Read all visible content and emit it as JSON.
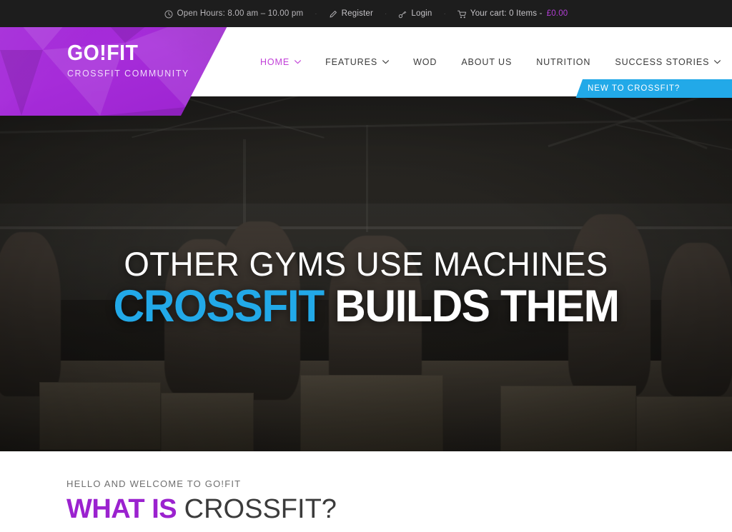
{
  "topbar": {
    "open_hours": "Open Hours: 8.00 am – 10.00 pm",
    "register": "Register",
    "login": "Login",
    "cart_label": "Your cart: 0 Items - ",
    "cart_price": "£0.00",
    "separator": "·",
    "icons": {
      "clock": "clock-icon",
      "register": "pencil-icon",
      "login": "key-icon",
      "cart": "cart-icon"
    }
  },
  "brand": {
    "name": "GO!FIT",
    "tagline": "CROSSFIT COMMUNITY"
  },
  "nav": {
    "items": [
      {
        "label": "HOME",
        "active": true,
        "dropdown": true
      },
      {
        "label": "FEATURES",
        "active": false,
        "dropdown": true
      },
      {
        "label": "WOD",
        "active": false,
        "dropdown": false
      },
      {
        "label": "ABOUT US",
        "active": false,
        "dropdown": false
      },
      {
        "label": "NUTRITION",
        "active": false,
        "dropdown": false
      },
      {
        "label": "SUCCESS STORIES",
        "active": false,
        "dropdown": true
      }
    ],
    "cta_label": "NEW TO CROSSFIT?"
  },
  "hero": {
    "line1": "OTHER GYMS USE MACHINES",
    "line2_accent": "CROSSFIT",
    "line2_rest": " BUILDS THEM"
  },
  "welcome": {
    "eyebrow": "HELLO AND WELCOME TO GO!FIT",
    "title_bold": "WHAT IS",
    "title_light": " CROSSFIT?"
  },
  "colors": {
    "brand_purple": "#9b22cf",
    "accent_blue": "#22a9e8",
    "topbar_bg": "#1d1d1d",
    "nav_active": "#c13fd8",
    "cart_price": "#b33ed6"
  }
}
